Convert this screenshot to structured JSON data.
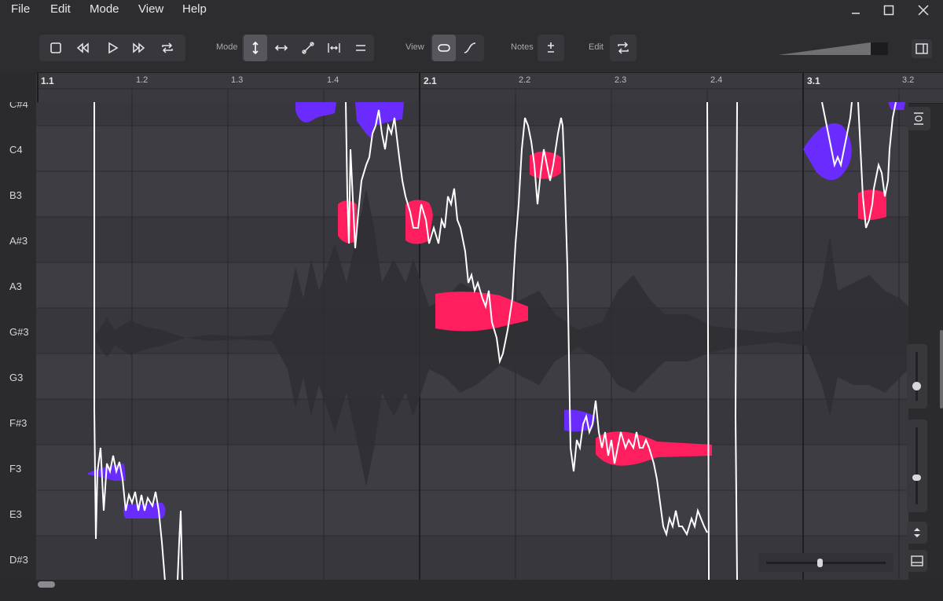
{
  "menu": {
    "file": "File",
    "edit": "Edit",
    "mode": "Mode",
    "view": "View",
    "help": "Help"
  },
  "window": {
    "minimize_icon": "minimize-icon",
    "maximize_icon": "maximize-icon",
    "close_icon": "close-icon"
  },
  "toolbar": {
    "mode_label": "Mode",
    "view_label": "View",
    "notes_label": "Notes",
    "edit_label": "Edit"
  },
  "ruler": {
    "labels": [
      "1.1",
      "1.2",
      "1.3",
      "1.4",
      "2.1",
      "2.2",
      "2.3",
      "2.4",
      "3.1",
      "3.2"
    ]
  },
  "pitch_keys": [
    "C#4",
    "C4",
    "B3",
    "A#3",
    "A3",
    "G#3",
    "G3",
    "F#3",
    "F3",
    "E3",
    "D#3"
  ],
  "colors": {
    "accent": "#ff2d6e",
    "note_blue": "#6a2bff",
    "note_pink": "#ff1f5f",
    "pitch_curve": "#ffffff",
    "grid_bg": "#3b3a40"
  }
}
